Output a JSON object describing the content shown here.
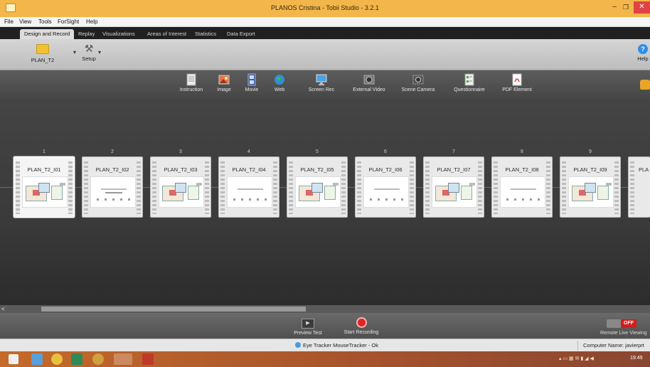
{
  "window": {
    "title": "PLANOS Cristina - Tobii Studio - 3.2.1"
  },
  "menu": [
    "File",
    "View",
    "Tools",
    "ForSight",
    "Help"
  ],
  "tabs": [
    {
      "label": "Design and Record",
      "active": true
    },
    {
      "label": "Replay"
    },
    {
      "label": "Visualizations"
    },
    {
      "label": "Areas of Interest"
    },
    {
      "label": "Statistics"
    },
    {
      "label": "Data Export"
    }
  ],
  "ribbon": {
    "test_name": "PLAN_T2",
    "setup": "Setup",
    "help": "Help",
    "help_glyph": "?"
  },
  "elements": [
    {
      "label": "Instruction",
      "icon": "instruction-icon"
    },
    {
      "label": "Image",
      "icon": "image-icon"
    },
    {
      "label": "Movie",
      "icon": "movie-icon"
    },
    {
      "label": "Web",
      "icon": "web-icon"
    },
    {
      "label": "Screen Rec",
      "icon": "screen-rec-icon"
    },
    {
      "label": "External Video",
      "icon": "external-video-icon"
    },
    {
      "label": "Scene Camera",
      "icon": "scene-camera-icon"
    },
    {
      "label": "Questionnaire",
      "icon": "questionnaire-icon"
    },
    {
      "label": "PDF Element",
      "icon": "pdf-element-icon"
    }
  ],
  "slides": [
    {
      "num": "1",
      "name": "PLAN_T2_I01",
      "kind": "plan",
      "selected": true
    },
    {
      "num": "2",
      "name": "PLAN_T2_I02",
      "kind": "question"
    },
    {
      "num": "3",
      "name": "PLAN_T2_I03",
      "kind": "plan"
    },
    {
      "num": "4",
      "name": "PLAN_T2_I04",
      "kind": "question"
    },
    {
      "num": "5",
      "name": "PLAN_T2_I05",
      "kind": "plan"
    },
    {
      "num": "6",
      "name": "PLAN_T2_I06",
      "kind": "question"
    },
    {
      "num": "7",
      "name": "PLAN_T2_I07",
      "kind": "plan"
    },
    {
      "num": "8",
      "name": "PLAN_T2_I08",
      "kind": "question"
    },
    {
      "num": "9",
      "name": "PLAN_T2_I09",
      "kind": "plan"
    },
    {
      "num": "",
      "name": "PLA",
      "kind": "question"
    }
  ],
  "controls": {
    "preview": "Preview Test",
    "record": "Start Recording",
    "toggle": "OFF",
    "remote": "Remote Live Viewing"
  },
  "status": {
    "eye_tracker": "Eye Tracker MouseTracker - Ok",
    "computer": "Computer Name: javierprt"
  },
  "taskbar": {
    "clock": "19:49"
  }
}
